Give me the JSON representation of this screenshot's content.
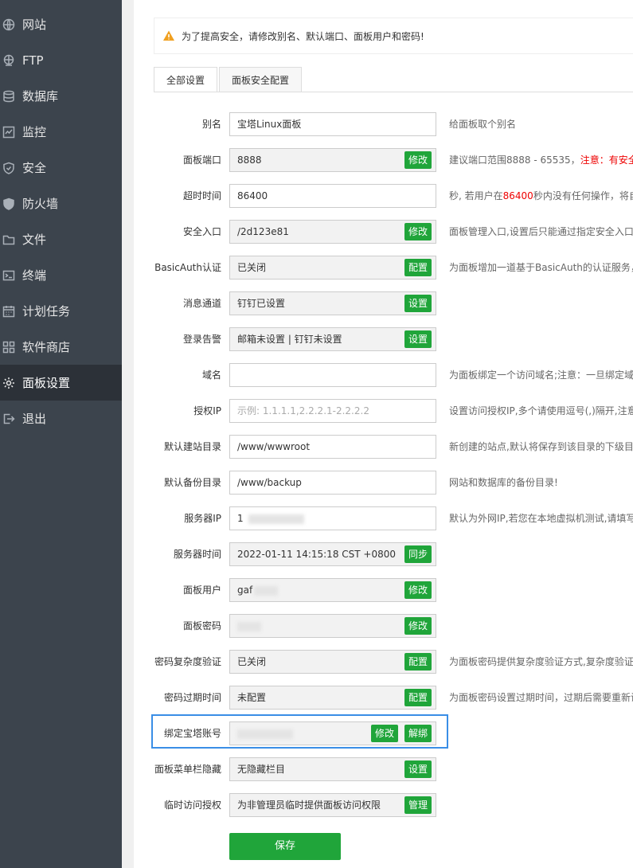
{
  "sidebar": {
    "items": [
      {
        "label": "网站",
        "icon": "globe-icon"
      },
      {
        "label": "FTP",
        "icon": "ftp-globe-icon"
      },
      {
        "label": "数据库",
        "icon": "database-icon"
      },
      {
        "label": "监控",
        "icon": "monitor-icon"
      },
      {
        "label": "安全",
        "icon": "shield-icon"
      },
      {
        "label": "防火墙",
        "icon": "firewall-shield-icon"
      },
      {
        "label": "文件",
        "icon": "folder-icon"
      },
      {
        "label": "终端",
        "icon": "terminal-icon"
      },
      {
        "label": "计划任务",
        "icon": "calendar-icon"
      },
      {
        "label": "软件商店",
        "icon": "apps-grid-icon"
      },
      {
        "label": "面板设置",
        "icon": "gear-icon"
      },
      {
        "label": "退出",
        "icon": "logout-icon"
      }
    ],
    "active_index": 10
  },
  "alert": {
    "text": "为了提高安全，请修改别名、默认端口、面板用户和密码!",
    "icon": "warning-icon",
    "icon_color": "#f0a020"
  },
  "tabs": [
    {
      "label": "全部设置",
      "active": true
    },
    {
      "label": "面板安全配置",
      "active": false
    }
  ],
  "settings": [
    {
      "label": "别名",
      "value": "宝塔Linux面板",
      "hint": "给面板取个别名"
    },
    {
      "label": "面板端口",
      "value": "8888",
      "button": "修改",
      "hint_prefix": "建议端口范围8888 - 65535，",
      "hint_red": "注意：有安全"
    },
    {
      "label": "超时时间",
      "value": "86400",
      "hint_prefix": "秒, 若用户在",
      "hint_red": "86400",
      "hint_suffix": "秒内没有任何操作，将自"
    },
    {
      "label": "安全入口",
      "value": "/2d123e81",
      "button": "修改",
      "hint": "面板管理入口,设置后只能通过指定安全入口"
    },
    {
      "label": "BasicAuth认证",
      "value": "已关闭",
      "button": "配置",
      "hint": "为面板增加一道基于BasicAuth的认证服务，"
    },
    {
      "label": "消息通道",
      "value": "钉钉已设置",
      "button": "设置"
    },
    {
      "label": "登录告警",
      "value": "邮箱未设置 | 钉钉未设置",
      "button": "设置"
    },
    {
      "label": "域名",
      "value": "",
      "hint": "为面板绑定一个访问域名;注意：一旦绑定域"
    },
    {
      "label": "授权IP",
      "value": "",
      "placeholder": "示例: 1.1.1.1,2.2.2.1-2.2.2.2",
      "hint": "设置访问授权IP,多个请使用逗号(,)隔开,注意"
    },
    {
      "label": "默认建站目录",
      "value": "/www/wwwroot",
      "hint": "新创建的站点,默认将保存到该目录的下级目"
    },
    {
      "label": "默认备份目录",
      "value": "/www/backup",
      "hint": "网站和数据库的备份目录!"
    },
    {
      "label": "服务器IP",
      "value": "1",
      "hint": "默认为外网IP,若您在本地虚拟机测试,请填写"
    },
    {
      "label": "服务器时间",
      "value": "2022-01-11 14:15:18 CST +0800",
      "button": "同步"
    },
    {
      "label": "面板用户",
      "value": "gaf",
      "button": "修改"
    },
    {
      "label": "面板密码",
      "value": "",
      "button": "修改"
    },
    {
      "label": "密码复杂度验证",
      "value": "已关闭",
      "button": "配置",
      "hint": "为面板密码提供复杂度验证方式,复杂度验证"
    },
    {
      "label": "密码过期时间",
      "value": "未配置",
      "button": "配置",
      "hint": "为面板密码设置过期时间，过期后需要重新设"
    },
    {
      "label": "绑定宝塔账号",
      "value": "",
      "button": "修改",
      "button2": "解绑"
    },
    {
      "label": "面板菜单栏隐藏",
      "value": "无隐藏栏目",
      "button": "设置"
    },
    {
      "label": "临时访问授权",
      "value": "为非管理员临时提供面板访问权限",
      "button": "管理"
    }
  ],
  "save_label": "保存",
  "colors": {
    "sidebar_bg": "#3c444d",
    "sidebar_active_bg": "#2c3138",
    "button_green": "#20a53a",
    "highlight_blue": "#3a8ee6",
    "warning_red": "#e00000"
  }
}
